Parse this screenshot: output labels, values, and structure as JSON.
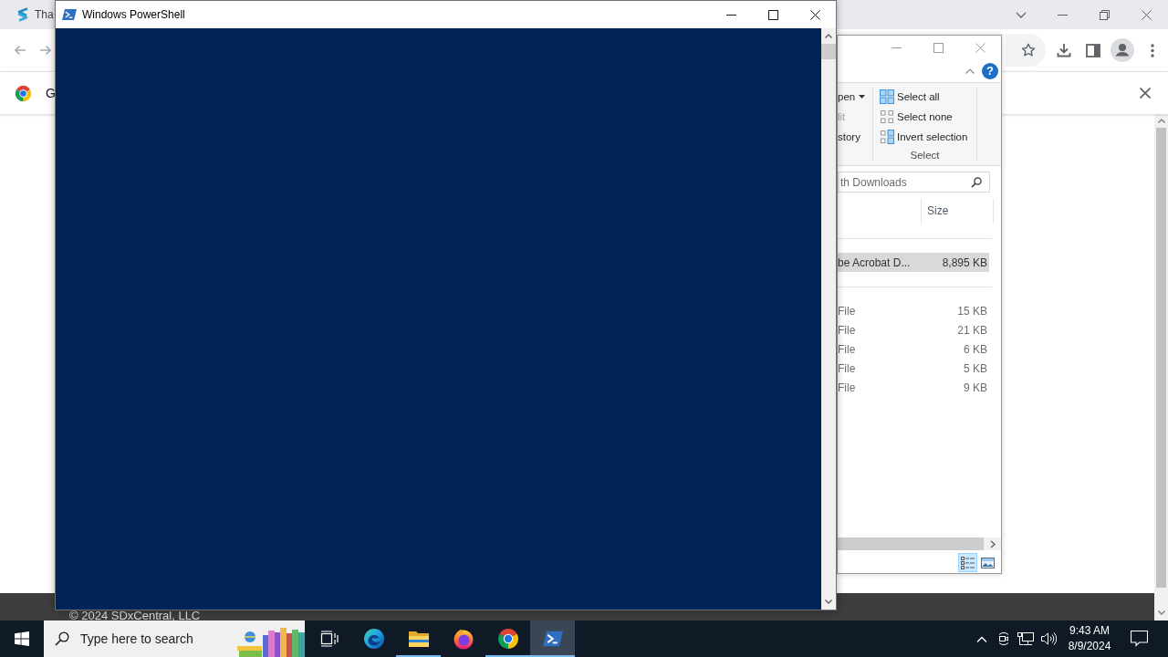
{
  "browser": {
    "tab": {
      "title": "Tha"
    },
    "infobar": {
      "text": "G"
    },
    "page": {
      "footer": "© 2024 SDxCentral, LLC"
    }
  },
  "explorer": {
    "ribbon": {
      "partial_group": [
        {
          "label": "pen",
          "kind": "dropdown",
          "disabled": false
        },
        {
          "label": "lit",
          "kind": "button",
          "disabled": true
        },
        {
          "label": "story",
          "kind": "button",
          "disabled": false
        }
      ],
      "select_group": {
        "label": "Select",
        "items": [
          {
            "label": "Select all",
            "kind": "all"
          },
          {
            "label": "Select none",
            "kind": "none"
          },
          {
            "label": "Invert selection",
            "kind": "invert"
          }
        ]
      },
      "help": "?"
    },
    "search": {
      "placeholder": "th Downloads"
    },
    "columns": [
      "Size"
    ],
    "groups": [
      {
        "rows": [
          {
            "column_1": "be Acrobat D...",
            "size": "8,895 KB",
            "selected": true
          }
        ]
      },
      {
        "rows": [
          {
            "column_1": "File",
            "size": "15 KB",
            "selected": false
          },
          {
            "column_1": "File",
            "size": "21 KB",
            "selected": false
          },
          {
            "column_1": "File",
            "size": "6 KB",
            "selected": false
          },
          {
            "column_1": "File",
            "size": "5 KB",
            "selected": false
          },
          {
            "column_1": "File",
            "size": "9 KB",
            "selected": false
          }
        ]
      }
    ],
    "views": [
      {
        "kind": "details",
        "selected": true
      },
      {
        "kind": "large_icons",
        "selected": false
      }
    ]
  },
  "powershell": {
    "title": "Windows PowerShell"
  },
  "taskbar": {
    "search": {
      "placeholder": "Type here to search"
    },
    "apps": [
      {
        "kind": "edge",
        "running": false,
        "active": false
      },
      {
        "kind": "explorer",
        "running": true,
        "active": false
      },
      {
        "kind": "firefox",
        "running": false,
        "active": false
      },
      {
        "kind": "chrome",
        "running": true,
        "active": false
      },
      {
        "kind": "powershell",
        "running": true,
        "active": true
      }
    ],
    "clock": {
      "time": "9:43 AM",
      "date": "8/9/2024"
    }
  }
}
